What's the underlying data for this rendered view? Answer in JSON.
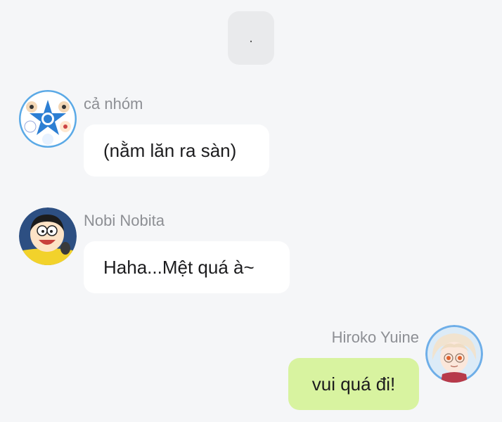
{
  "top_bubble": {
    "text": "."
  },
  "messages": [
    {
      "sender": "cả nhóm",
      "text": "(nằm lăn ra sàn)",
      "avatar_icon": "group-avatar-icon",
      "bubble_color": "#ffffff"
    },
    {
      "sender": "Nobi Nobita",
      "text": "Haha...Mệt quá à~",
      "avatar_icon": "nobita-avatar-icon",
      "bubble_color": "#ffffff"
    },
    {
      "sender": "Hiroko Yuine",
      "text": "vui quá đi!",
      "avatar_icon": "hiroko-avatar-icon",
      "bubble_color": "#d8f3a0"
    }
  ],
  "colors": {
    "background": "#f5f6f8",
    "own_bubble": "#d8f3a0",
    "other_bubble": "#ffffff",
    "sender_name": "#8d8f94"
  }
}
